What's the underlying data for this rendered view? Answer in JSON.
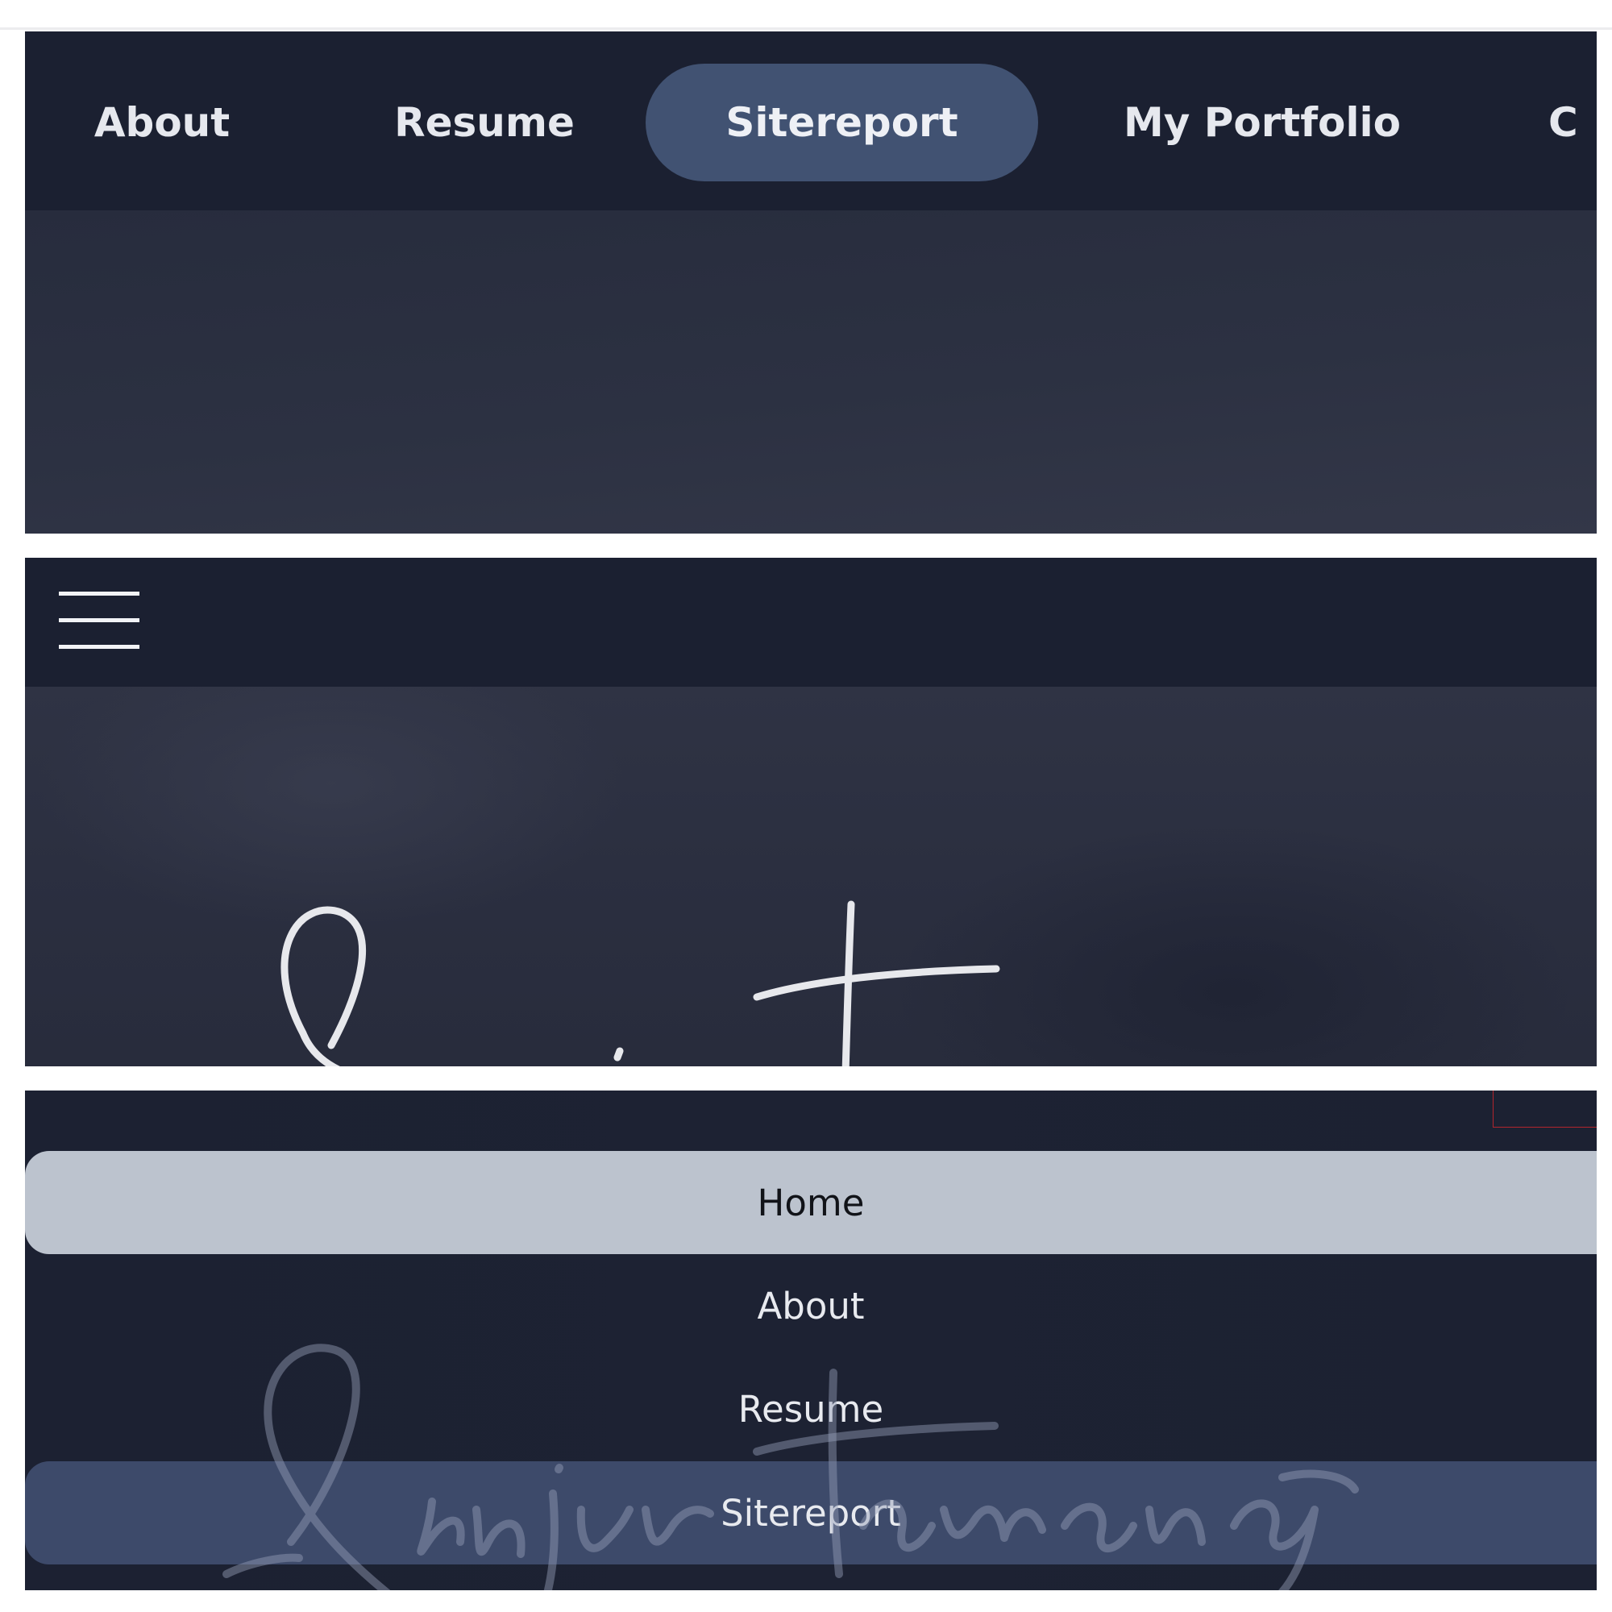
{
  "desktop_nav": {
    "items": [
      {
        "label": "About"
      },
      {
        "label": "Resume"
      },
      {
        "label": "Sitereport"
      },
      {
        "label": "My Portfolio"
      },
      {
        "label": "C"
      }
    ],
    "active_index": 2
  },
  "mobile_menu": {
    "items": [
      {
        "label": "Home"
      },
      {
        "label": "About"
      },
      {
        "label": "Resume"
      },
      {
        "label": "Sitereport"
      }
    ]
  },
  "signature": {
    "text": "Sanjiv Tamang"
  },
  "colors": {
    "navbar": "#1b2031",
    "active_pill": "#415272",
    "home_pill": "#bcc3ce",
    "nav_text": "#e6e8ee"
  }
}
